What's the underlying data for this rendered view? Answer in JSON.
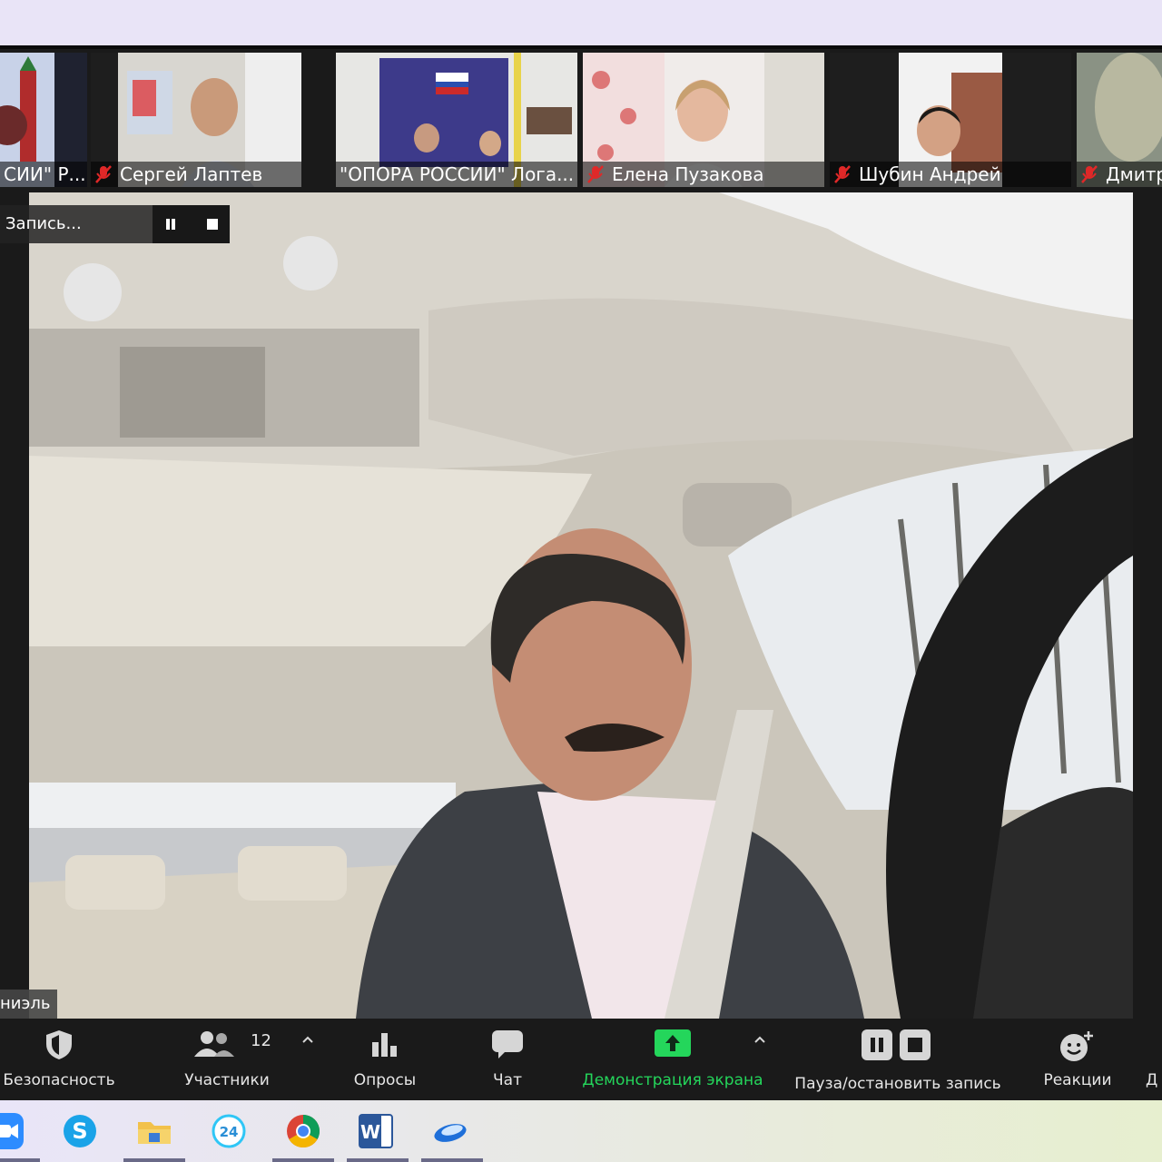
{
  "recording": {
    "label": "Запись..."
  },
  "participants": [
    {
      "name": "СИИ\" Р..."
    },
    {
      "name": "Сергей Лаптев"
    },
    {
      "name": "\"ОПОРА РОССИИ\" Лога..."
    },
    {
      "name": "Елена Пузакова"
    },
    {
      "name": "Шубин Андрей"
    },
    {
      "name": "Дмитр"
    }
  ],
  "active_speaker": {
    "name_fragment": "ниэль"
  },
  "toolbar": {
    "security": "Безопасность",
    "participants": "Участники",
    "participants_count": "12",
    "polls": "Опросы",
    "chat": "Чат",
    "share_screen": "Демонстрация экрана",
    "pause_stop_recording": "Пауза/остановить запись",
    "reactions": "Реакции",
    "more_fragment": "Д"
  },
  "colors": {
    "share_green": "#24d65b",
    "toolbar_bg": "#1a1a1a",
    "mic_muted_red": "#e02828"
  },
  "taskbar": {
    "apps": [
      {
        "icon": "zoom-icon"
      },
      {
        "icon": "skype-icon"
      },
      {
        "icon": "file-explorer-icon"
      },
      {
        "icon": "bitrix24-icon"
      },
      {
        "icon": "chrome-icon"
      },
      {
        "icon": "word-icon"
      },
      {
        "icon": "app-cloud-icon"
      }
    ]
  }
}
